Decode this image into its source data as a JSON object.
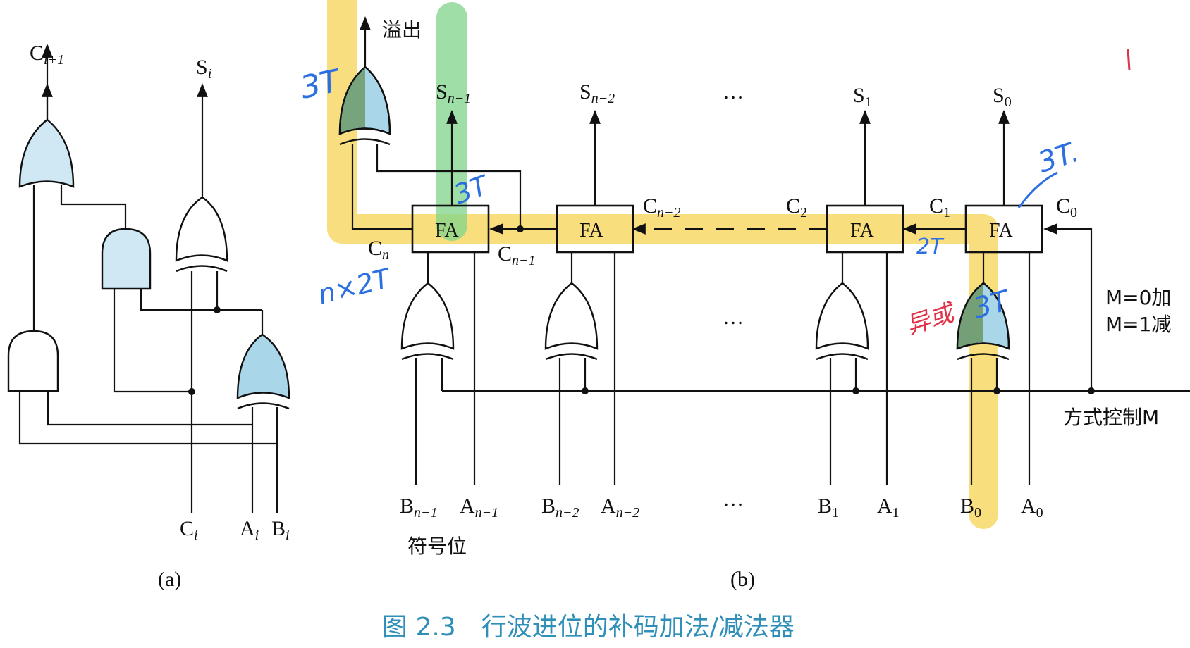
{
  "figure": {
    "caption": "图 2.3　行波进位的补码加法/减法器",
    "part_a_label": "(a)",
    "part_b_label": "(b)"
  },
  "part_a": {
    "carry_out": {
      "base": "C",
      "sub": "i+1"
    },
    "sum_out": {
      "base": "S",
      "sub": "i"
    },
    "in_c": {
      "base": "C",
      "sub": "i"
    },
    "in_a": {
      "base": "A",
      "sub": "i"
    },
    "in_b": {
      "base": "B",
      "sub": "i"
    }
  },
  "part_b": {
    "overflow": "溢出",
    "fa_label": "FA",
    "sign_bit": "符号位",
    "control": "方式控制M",
    "mode_add": "M=0加",
    "mode_sub": "M=1减",
    "ellipsis": "…",
    "outputs": [
      {
        "base": "S",
        "sub": "n−1"
      },
      {
        "base": "S",
        "sub": "n−2"
      },
      {
        "base": "S",
        "sub": "1"
      },
      {
        "base": "S",
        "sub": "0"
      }
    ],
    "carries": {
      "cn": {
        "base": "C",
        "sub": "n"
      },
      "cn1": {
        "base": "C",
        "sub": "n−1"
      },
      "cn2": {
        "base": "C",
        "sub": "n−2"
      },
      "c2": {
        "base": "C",
        "sub": "2"
      },
      "c1": {
        "base": "C",
        "sub": "1"
      },
      "c0": {
        "base": "C",
        "sub": "0"
      }
    },
    "inputs": [
      {
        "b": {
          "base": "B",
          "sub": "n−1"
        },
        "a": {
          "base": "A",
          "sub": "n−1"
        }
      },
      {
        "b": {
          "base": "B",
          "sub": "n−2"
        },
        "a": {
          "base": "A",
          "sub": "n−2"
        }
      },
      {
        "b": {
          "base": "B",
          "sub": "1"
        },
        "a": {
          "base": "A",
          "sub": "1"
        }
      },
      {
        "b": {
          "base": "B",
          "sub": "0"
        },
        "a": {
          "base": "A",
          "sub": "0"
        }
      }
    ]
  },
  "annotations": {
    "t_overflow": "3T",
    "t_fa_top": "3T",
    "t_fa0": "3T.",
    "t_carry": "2T",
    "t_xor0": "3T",
    "t_chain": "n×2T",
    "xor_note": "异或"
  },
  "colors": {
    "highlight_yellow": "#f7d55a",
    "highlight_green": "#7fd48a",
    "gate_blue": "#cfe8f3",
    "gate_blue_dark": "#a9d6e8",
    "gate_green": "#6f9a6a",
    "caption": "#2f8fb8",
    "pen_blue": "#2b6fe0",
    "pen_red": "#e0334a"
  }
}
